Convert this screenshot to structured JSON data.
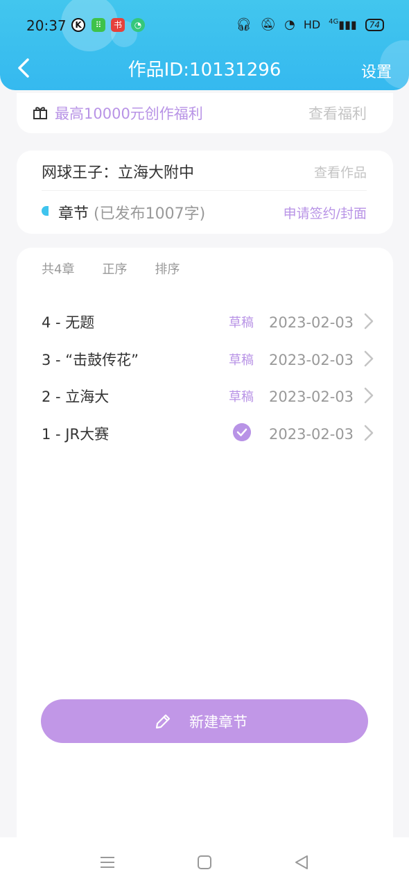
{
  "status_bar": {
    "time": "20:37",
    "app_icons": [
      "K",
      "⠿",
      "书",
      "◔"
    ],
    "network": "HD",
    "signal": "4G",
    "battery": "74"
  },
  "header": {
    "title": "作品ID:10131296",
    "settings_label": "设置"
  },
  "welfare": {
    "text": "最高10000元创作福利",
    "link": "查看福利"
  },
  "work": {
    "title": "网球王子：立海大附中",
    "view_link": "查看作品",
    "chapter_label": "章节",
    "chapter_count": "(已发布1007字)",
    "apply_link": "申请签约/封面"
  },
  "chapter_list": {
    "total": "共4章",
    "order": "正序",
    "sort": "排序",
    "rows": [
      {
        "title": "4 - 无题",
        "status": "草稿",
        "date": "2023-02-03"
      },
      {
        "title": "3 - “击鼓传花”",
        "status": "草稿",
        "date": "2023-02-03"
      },
      {
        "title": "2 - 立海大",
        "status": "草稿",
        "date": "2023-02-03"
      },
      {
        "title": "1 - JR大赛",
        "status": "",
        "date": "2023-02-03"
      }
    ]
  },
  "new_chapter_button": "新建章节",
  "colors": {
    "header_blue": "#3bbff0",
    "accent_purple": "#b893e6",
    "button_purple": "#c197e7"
  }
}
